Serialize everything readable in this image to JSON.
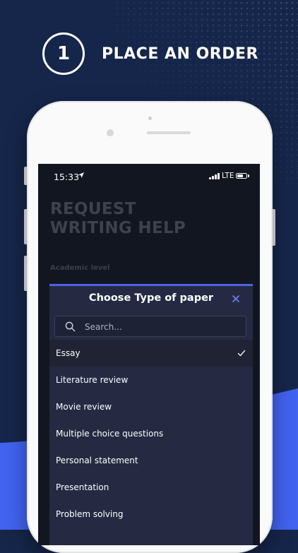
{
  "step": {
    "number": "1",
    "title": "PLACE AN ORDER"
  },
  "status_bar": {
    "time": "15:33",
    "network": "LTE"
  },
  "page": {
    "title": "REQUEST\nWRITING HELP",
    "field_label": "Academic level"
  },
  "modal": {
    "title": "Choose Type of paper",
    "close_icon": "close-icon",
    "search": {
      "placeholder": "Search...",
      "value": ""
    },
    "options": [
      {
        "label": "Essay",
        "selected": true
      },
      {
        "label": "Literature review",
        "selected": false
      },
      {
        "label": "Movie review",
        "selected": false
      },
      {
        "label": "Multiple choice questions",
        "selected": false
      },
      {
        "label": "Personal statement",
        "selected": false
      },
      {
        "label": "Presentation",
        "selected": false
      },
      {
        "label": "Problem solving",
        "selected": false
      }
    ]
  },
  "colors": {
    "background": "#16264a",
    "accent": "#4b63e6",
    "modal": "#252a42",
    "screen": "#121620"
  }
}
